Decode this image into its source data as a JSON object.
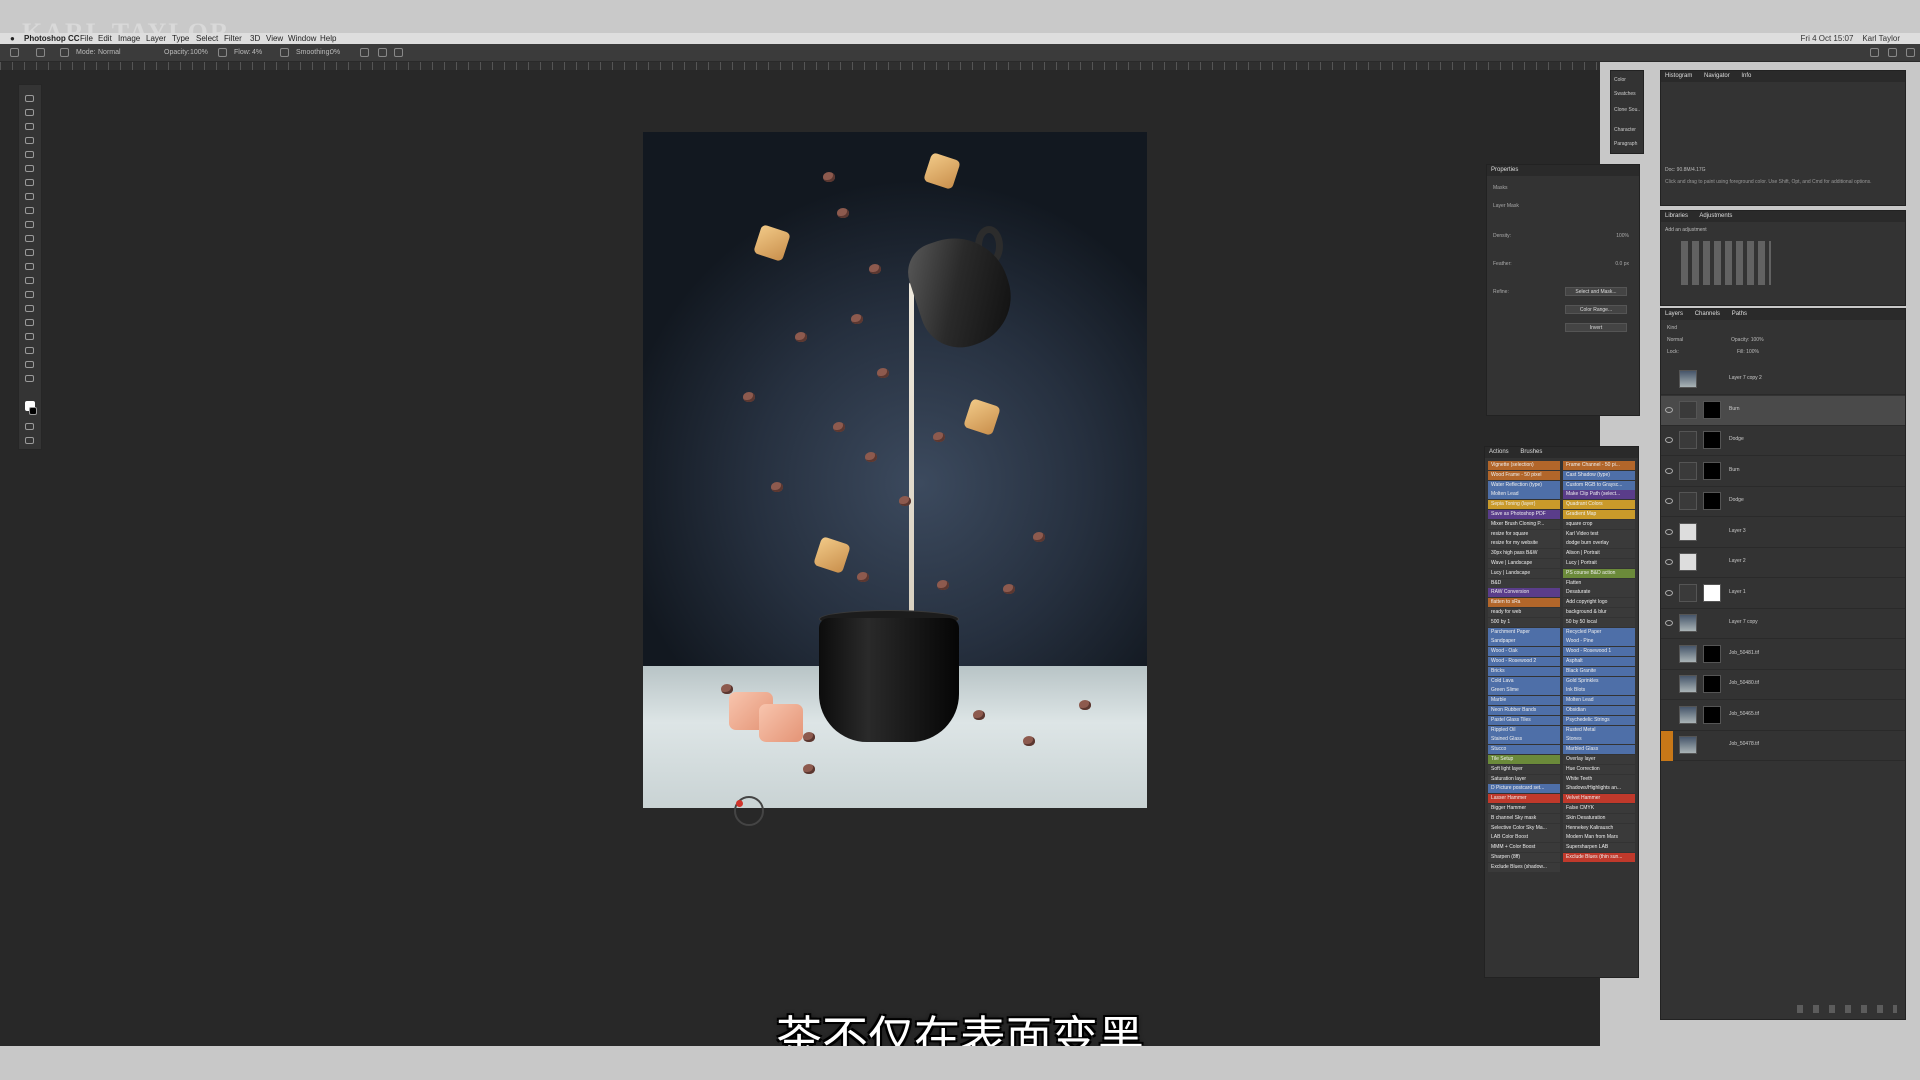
{
  "watermark": "KARL TAYLOR",
  "menubar": {
    "app": "Photoshop CC",
    "items": [
      "File",
      "Edit",
      "Image",
      "Layer",
      "Type",
      "Select",
      "Filter",
      "3D",
      "View",
      "Window",
      "Help"
    ],
    "clock": "Fri 4 Oct 15:07",
    "user": "Karl Taylor"
  },
  "options": {
    "mode_label": "Mode:",
    "mode_value": "Normal",
    "opacity_label": "Opacity:",
    "opacity_value": "100%",
    "flow_label": "Flow:",
    "flow_value": "4%",
    "smoothing_label": "Smoothing:",
    "smoothing_value": "0%"
  },
  "dock": {
    "items": [
      "Color",
      "Swatches",
      "Clone Sou..",
      "Character",
      "Paragraph"
    ]
  },
  "info_panel": {
    "tabs": [
      "Histogram",
      "Navigator",
      "Info"
    ],
    "doc": "Doc: 90.8M/4.17G",
    "hint": "Click and drag to paint using foreground color. Use Shift, Opt, and Cmd for additional options."
  },
  "adjustments_panel": {
    "tabs": [
      "Libraries",
      "Adjustments"
    ],
    "subtitle": "Add an adjustment"
  },
  "properties_panel": {
    "title": "Properties",
    "masks_label": "Masks",
    "layer_mask_label": "Layer Mask",
    "density_label": "Density:",
    "density_value": "100%",
    "feather_label": "Feather:",
    "feather_value": "0.0 px",
    "refine_label": "Refine:",
    "btn_select_mask": "Select and Mask...",
    "btn_color_range": "Color Range...",
    "btn_invert": "Invert"
  },
  "actions_panel": {
    "tabs": [
      "Actions",
      "Brushes"
    ],
    "left": [
      {
        "label": "Vignette (selection)",
        "color": "#b2662a"
      },
      {
        "label": "Wood Frame - 50 pixel",
        "color": "#b2662a"
      },
      {
        "label": "Water Reflection (type)",
        "color": "#4e6fa8"
      },
      {
        "label": "Molten Lead",
        "color": "#4e6fa8"
      },
      {
        "label": "Sepia Toning (layer)",
        "color": "#c99a2a"
      },
      {
        "label": "Save as Photoshop PDF",
        "color": "#5a3d8a"
      },
      {
        "label": "Mixer Brush Cloning P...",
        "color": "#3a3a3a"
      },
      {
        "label": "resize for square",
        "color": "#3a3a3a"
      },
      {
        "label": "resize for my website",
        "color": "#3a3a3a"
      },
      {
        "label": "30px high pass B&W",
        "color": "#3a3a3a"
      },
      {
        "label": "Wave | Landscape",
        "color": "#3a3a3a"
      },
      {
        "label": "Lucy | Landscape",
        "color": "#3a3a3a"
      },
      {
        "label": "B&D",
        "color": "#3a3a3a"
      },
      {
        "label": "RAW Conversion",
        "color": "#5a3d8a"
      },
      {
        "label": "flatten to sRa",
        "color": "#b2662a"
      },
      {
        "label": "ready for web",
        "color": "#3a3a3a"
      },
      {
        "label": "500 by 1",
        "color": "#3a3a3a"
      },
      {
        "label": "Parchment Paper",
        "color": "#4e6fa8"
      },
      {
        "label": "Sandpaper",
        "color": "#4e6fa8"
      },
      {
        "label": "Wood - Oak",
        "color": "#4e6fa8"
      },
      {
        "label": "Wood - Rosewood 2",
        "color": "#4e6fa8"
      },
      {
        "label": "Bricks",
        "color": "#4e6fa8"
      },
      {
        "label": "Cold Lava",
        "color": "#4e6fa8"
      },
      {
        "label": "Green Slime",
        "color": "#4e6fa8"
      },
      {
        "label": "Marble",
        "color": "#4e6fa8"
      },
      {
        "label": "Neon Rubber Bands",
        "color": "#4e6fa8"
      },
      {
        "label": "Pastel Glass Tiles",
        "color": "#4e6fa8"
      },
      {
        "label": "Rippled Oil",
        "color": "#4e6fa8"
      },
      {
        "label": "Stained Glass",
        "color": "#4e6fa8"
      },
      {
        "label": "Stucco",
        "color": "#4e6fa8"
      },
      {
        "label": "Tile Setup",
        "color": "#6b8a3a"
      },
      {
        "label": "Soft light layer",
        "color": "#3a3a3a"
      },
      {
        "label": "Saturation layer",
        "color": "#3a3a3a"
      },
      {
        "label": "D Picture postcard set...",
        "color": "#4e6fa8"
      },
      {
        "label": "Lasser Hammer",
        "color": "#c0392b"
      },
      {
        "label": "Bigger Hammer",
        "color": "#3a3a3a"
      },
      {
        "label": "B channel Sky mask",
        "color": "#3a3a3a"
      },
      {
        "label": "Selective Color Sky Ma...",
        "color": "#3a3a3a"
      },
      {
        "label": "LAB Color Boost",
        "color": "#3a3a3a"
      },
      {
        "label": "MMM + Color Boost",
        "color": "#3a3a3a"
      },
      {
        "label": "Sharpen (8ff)",
        "color": "#3a3a3a"
      },
      {
        "label": "Exclude Blues (shadow...",
        "color": "#3a3a3a"
      }
    ],
    "right": [
      {
        "label": "Frame Channel - 50 pi...",
        "color": "#b2662a"
      },
      {
        "label": "Cast Shadow (type)",
        "color": "#4e6fa8"
      },
      {
        "label": "Custom RGB to Graysc...",
        "color": "#4e6fa8"
      },
      {
        "label": "Make Clip Path (select...",
        "color": "#5a3d8a"
      },
      {
        "label": "Quadrant Colors",
        "color": "#c99a2a"
      },
      {
        "label": "Gradient Map",
        "color": "#c99a2a"
      },
      {
        "label": "square crop",
        "color": "#3a3a3a"
      },
      {
        "label": "Karl Video test",
        "color": "#3a3a3a"
      },
      {
        "label": "dodge burn overlay",
        "color": "#3a3a3a"
      },
      {
        "label": "Alison | Portrait",
        "color": "#3a3a3a"
      },
      {
        "label": "Lucy | Portrait",
        "color": "#3a3a3a"
      },
      {
        "label": "PS course B&D action",
        "color": "#6b8a3a"
      },
      {
        "label": "Flatten",
        "color": "#3a3a3a"
      },
      {
        "label": "Desaturate",
        "color": "#3a3a3a"
      },
      {
        "label": "Add copyright logo",
        "color": "#3a3a3a"
      },
      {
        "label": "background & blur",
        "color": "#3a3a3a"
      },
      {
        "label": "50 by 50 local",
        "color": "#3a3a3a"
      },
      {
        "label": "Recycled Paper",
        "color": "#4e6fa8"
      },
      {
        "label": "Wood - Pine",
        "color": "#4e6fa8"
      },
      {
        "label": "Wood - Rosewood 1",
        "color": "#4e6fa8"
      },
      {
        "label": "Asphalt",
        "color": "#4e6fa8"
      },
      {
        "label": "Black Granite",
        "color": "#4e6fa8"
      },
      {
        "label": "Gold Sprinkles",
        "color": "#4e6fa8"
      },
      {
        "label": "Ink Blots",
        "color": "#4e6fa8"
      },
      {
        "label": "Molten Lead",
        "color": "#4e6fa8"
      },
      {
        "label": "Obsidian",
        "color": "#4e6fa8"
      },
      {
        "label": "Psychedelic Strings",
        "color": "#4e6fa8"
      },
      {
        "label": "Rusted Metal",
        "color": "#4e6fa8"
      },
      {
        "label": "Stones",
        "color": "#4e6fa8"
      },
      {
        "label": "Marbled Glass",
        "color": "#4e6fa8"
      },
      {
        "label": "Overlay layer",
        "color": "#3a3a3a"
      },
      {
        "label": "Hue Correction",
        "color": "#3a3a3a"
      },
      {
        "label": "White Teeth",
        "color": "#3a3a3a"
      },
      {
        "label": "Shadows/Highlights an...",
        "color": "#3a3a3a"
      },
      {
        "label": "Velvet Hammer",
        "color": "#c0392b"
      },
      {
        "label": "False CMYK",
        "color": "#3a3a3a"
      },
      {
        "label": "Skin Desaturation",
        "color": "#3a3a3a"
      },
      {
        "label": "Hennekey Kalirausch",
        "color": "#3a3a3a"
      },
      {
        "label": "Modern Man from Mars",
        "color": "#3a3a3a"
      },
      {
        "label": "Supersharpen LAB",
        "color": "#3a3a3a"
      },
      {
        "label": "Exclude Blues (thin sun...",
        "color": "#c0392b"
      }
    ]
  },
  "layers_panel": {
    "tabs": [
      "Layers",
      "Channels",
      "Paths"
    ],
    "kind_label": "Kind",
    "blend_mode": "Normal",
    "opacity_label": "Opacity:",
    "opacity_value": "100%",
    "lock_label": "Lock:",
    "fill_label": "Fill:",
    "fill_value": "100%",
    "layers": [
      {
        "name": "Layer 7 copy 2",
        "visible": false,
        "selected": false
      },
      {
        "name": "Burn",
        "visible": true,
        "selected": true
      },
      {
        "name": "Dodge",
        "visible": true,
        "selected": false
      },
      {
        "name": "Burn",
        "visible": true,
        "selected": false
      },
      {
        "name": "Dodge",
        "visible": true,
        "selected": false
      },
      {
        "name": "Layer 3",
        "visible": true,
        "selected": false
      },
      {
        "name": "Layer 2",
        "visible": true,
        "selected": false
      },
      {
        "name": "Layer 1",
        "visible": true,
        "selected": false
      },
      {
        "name": "Layer 7 copy",
        "visible": true,
        "selected": false
      },
      {
        "name": "Job_50481.tif",
        "visible": false,
        "selected": false
      },
      {
        "name": "Job_50480.tif",
        "visible": false,
        "selected": false
      },
      {
        "name": "Job_50465.tif",
        "visible": false,
        "selected": false
      },
      {
        "name": "Job_50478.tif",
        "visible": false,
        "selected": false
      }
    ]
  },
  "subtitle": "茶不仅在表面变黑"
}
